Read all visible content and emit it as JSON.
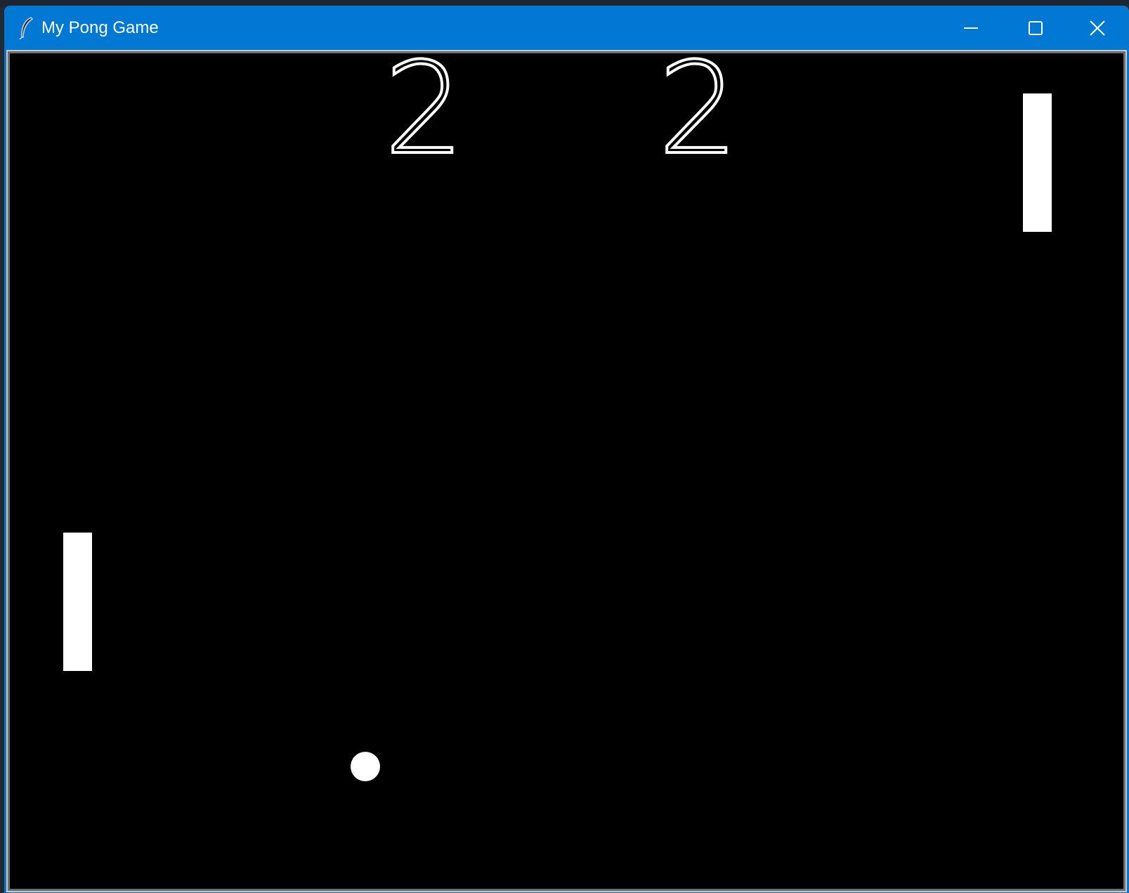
{
  "window": {
    "title": "My Pong Game",
    "app_icon": "feather-icon",
    "controls": {
      "minimize_icon": "minimize-icon",
      "maximize_icon": "maximize-icon",
      "close_icon": "close-icon"
    },
    "accent_color": "#0078d4"
  },
  "game": {
    "background_color": "#000000",
    "foreground_color": "#ffffff",
    "score": {
      "left": "2",
      "right": "2"
    }
  }
}
